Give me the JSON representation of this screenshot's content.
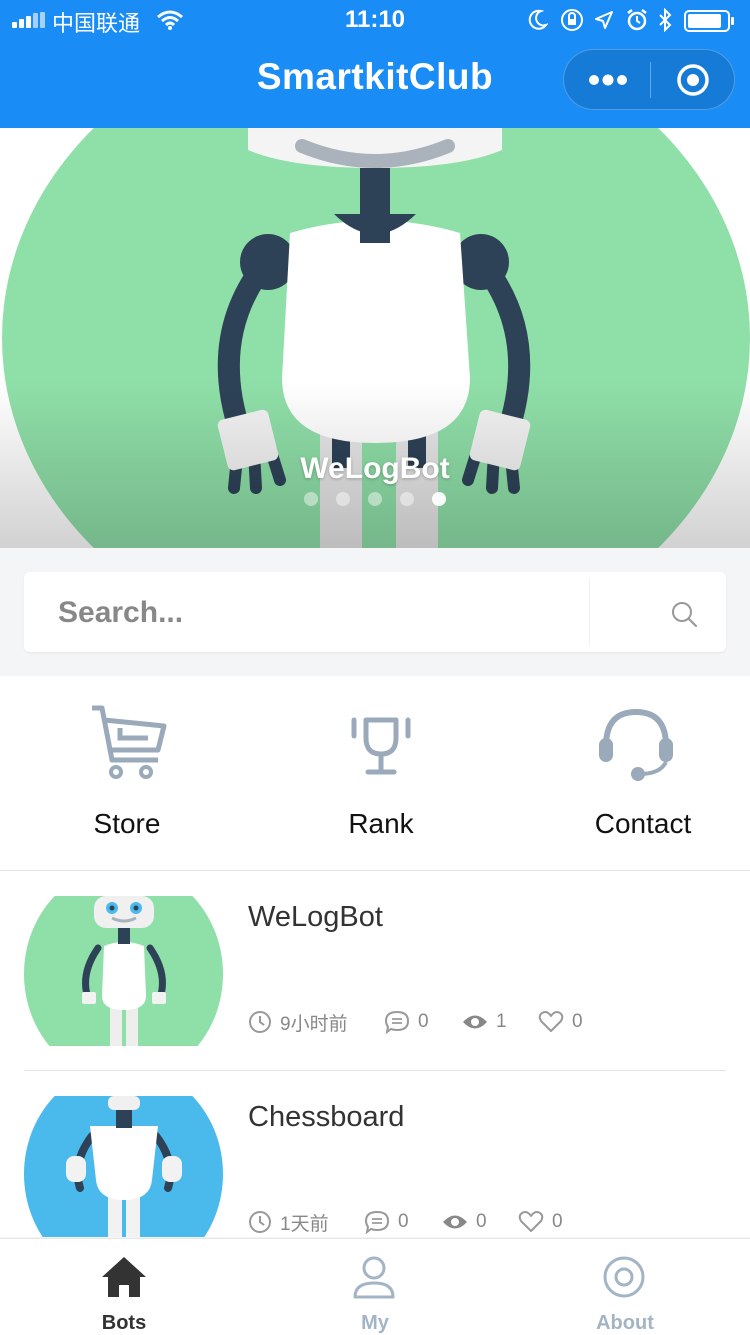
{
  "status_bar": {
    "carrier": "中国联通",
    "time": "11:10",
    "wifi_icon": "wifi-icon",
    "battery_icon": "battery-icon"
  },
  "nav": {
    "title": "SmartkitClub",
    "more_icon": "more-dots-icon",
    "close_icon": "target-circle-icon"
  },
  "banner": {
    "caption": "WeLogBot",
    "slide_count": 5,
    "active_slide": 5,
    "colors": {
      "green": "#8fdfa8",
      "navy": "#2e4257"
    }
  },
  "search": {
    "placeholder": "Search...",
    "value": "",
    "icon": "search-icon"
  },
  "quick_actions": [
    {
      "label": "Store",
      "icon": "cart-icon"
    },
    {
      "label": "Rank",
      "icon": "trophy-icon"
    },
    {
      "label": "Contact",
      "icon": "headset-icon"
    }
  ],
  "bots": [
    {
      "title": "WeLogBot",
      "time": "9小时前",
      "comments": "0",
      "views": "1",
      "likes": "0",
      "theme": "#8fdfa8"
    },
    {
      "title": "Chessboard",
      "time": "1天前",
      "comments": "0",
      "views": "0",
      "likes": "0",
      "theme": "#4ab9ec"
    }
  ],
  "tabs": [
    {
      "label": "Bots",
      "icon": "home-icon",
      "active": true
    },
    {
      "label": "My",
      "icon": "user-icon",
      "active": false
    },
    {
      "label": "About",
      "icon": "target-icon",
      "active": false
    }
  ],
  "colors": {
    "primary": "#1a8cf5",
    "tab_active": "#333333",
    "tab_inactive": "#a3b4c5",
    "icon_gray": "#9aaabb"
  }
}
